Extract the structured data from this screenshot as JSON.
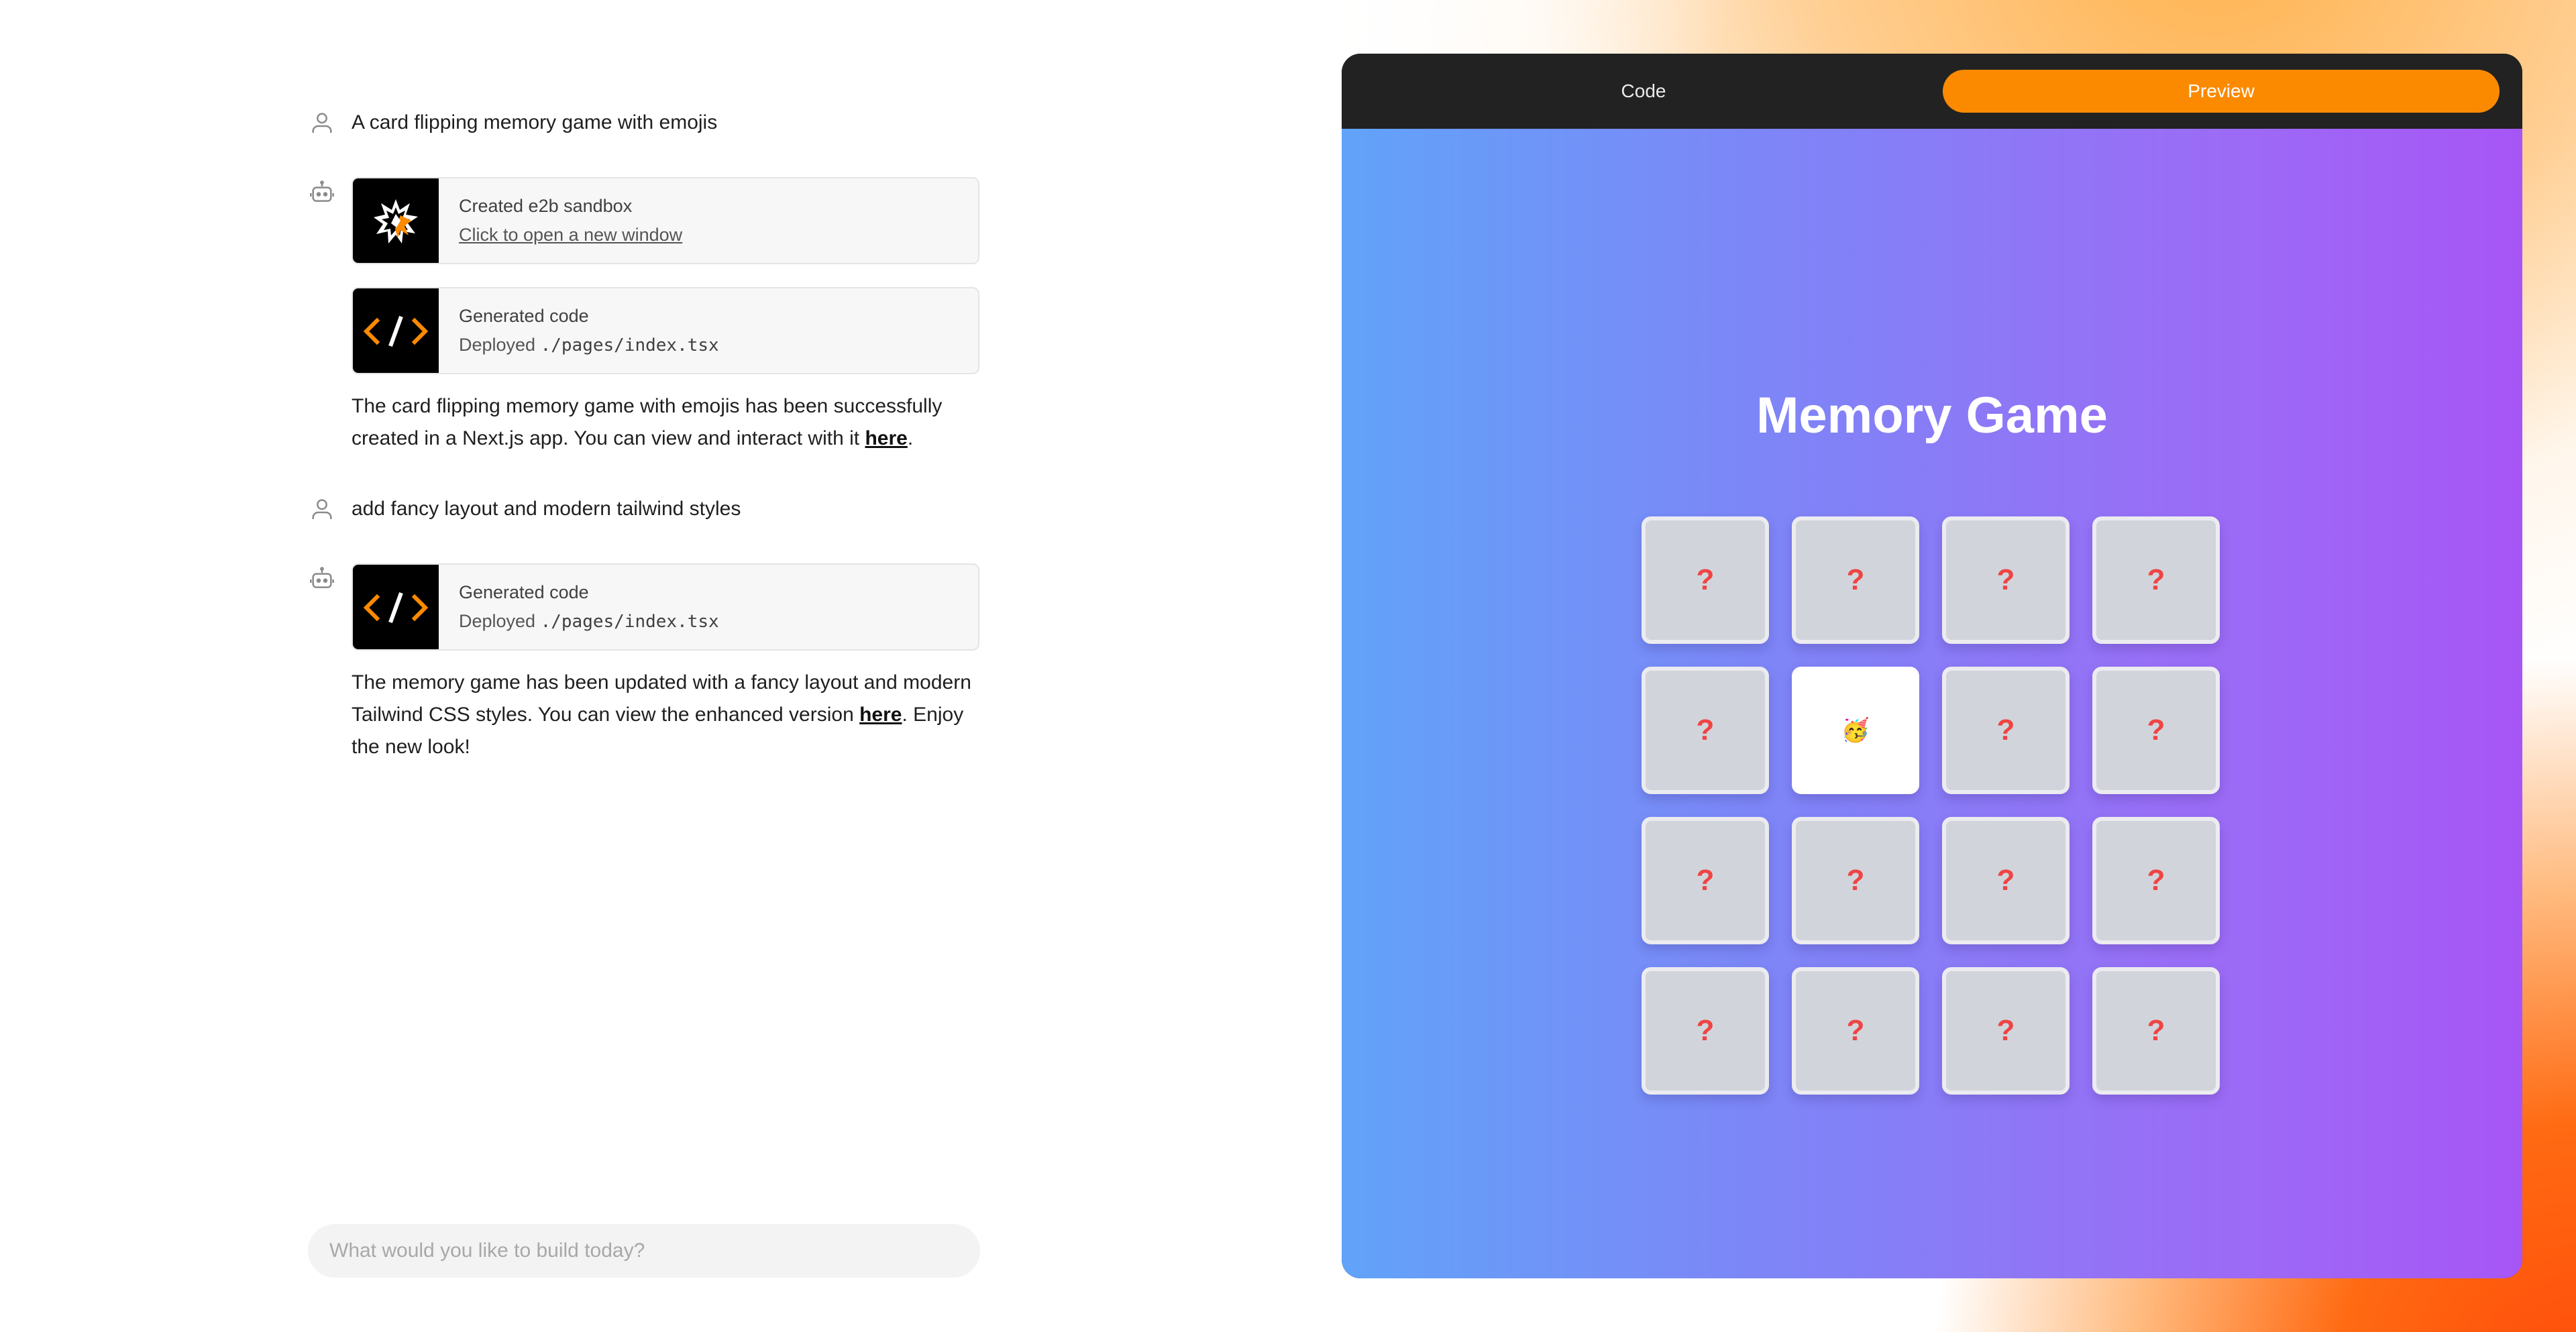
{
  "chat": {
    "messages": [
      {
        "role": "user",
        "text": "A card flipping memory game with emojis"
      },
      {
        "role": "assistant",
        "cards": [
          {
            "kind": "sandbox",
            "title": "Created e2b sandbox",
            "subtitle": "Click to open a new window"
          },
          {
            "kind": "code",
            "title": "Generated code",
            "subtitle_prefix": "Deployed",
            "file": "./pages/index.tsx"
          }
        ],
        "text_before": "The card flipping memory game with emojis has been successfully created in a Next.js app. You can view and interact with it ",
        "link": "here",
        "text_after": "."
      },
      {
        "role": "user",
        "text": "add fancy layout and modern tailwind styles"
      },
      {
        "role": "assistant",
        "cards": [
          {
            "kind": "code",
            "title": "Generated code",
            "subtitle_prefix": "Deployed",
            "file": "./pages/index.tsx"
          }
        ],
        "text_before": "The memory game has been updated with a fancy layout and modern Tailwind CSS styles. You can view the enhanced version ",
        "link": "here",
        "text_after": ". Enjoy the new look!"
      }
    ],
    "icons": {
      "user": "user-icon",
      "assistant": "bot-icon",
      "sandbox": "e2b-logo-icon",
      "code": "code-brackets-icon"
    }
  },
  "input": {
    "placeholder": "What would you like to build today?",
    "value": ""
  },
  "preview": {
    "tabs": [
      {
        "label": "Code",
        "active": false
      },
      {
        "label": "Preview",
        "active": true
      }
    ],
    "accent_color": "#fb8a00",
    "game": {
      "title": "Memory Game",
      "hidden_symbol": "?",
      "tiles": [
        {
          "face": "?",
          "flipped": false
        },
        {
          "face": "?",
          "flipped": false
        },
        {
          "face": "?",
          "flipped": false
        },
        {
          "face": "?",
          "flipped": false
        },
        {
          "face": "?",
          "flipped": false
        },
        {
          "face": "🥳",
          "flipped": true
        },
        {
          "face": "?",
          "flipped": false
        },
        {
          "face": "?",
          "flipped": false
        },
        {
          "face": "?",
          "flipped": false
        },
        {
          "face": "?",
          "flipped": false
        },
        {
          "face": "?",
          "flipped": false
        },
        {
          "face": "?",
          "flipped": false
        },
        {
          "face": "?",
          "flipped": false
        },
        {
          "face": "?",
          "flipped": false
        },
        {
          "face": "?",
          "flipped": false
        },
        {
          "face": "?",
          "flipped": false
        }
      ],
      "gradient": [
        "#61a3f9",
        "#a756f6"
      ],
      "question_color": "#ef4444"
    }
  }
}
